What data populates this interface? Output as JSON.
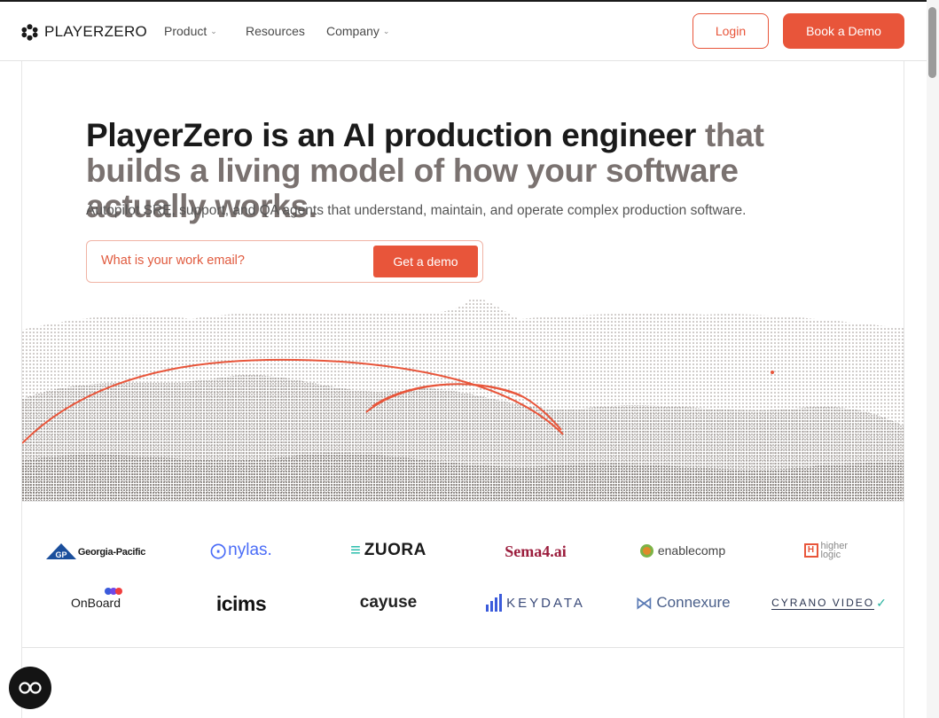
{
  "nav": {
    "brand": "PLAYERZERO",
    "items": [
      {
        "label": "Product",
        "has_dropdown": true
      },
      {
        "label": "Resources",
        "has_dropdown": false
      },
      {
        "label": "Company",
        "has_dropdown": true
      }
    ],
    "login_label": "Login",
    "book_demo_label": "Book a Demo"
  },
  "hero": {
    "headline_strong": "PlayerZero is an AI production engineer",
    "headline_muted": " that builds a living model of how your software actually works.",
    "subhead": "Autopilot SRE, support, and QA agents that understand, maintain, and operate complex production software.",
    "email_placeholder": "What is your work email?",
    "cta_label": "Get a demo"
  },
  "customer_logos": {
    "row1": [
      "Georgia-Pacific",
      "nylas.",
      "ZUORA",
      "Sema4.ai",
      "enablecomp",
      "higher logic"
    ],
    "row2": [
      "OnBoard",
      "icims",
      "cayuse",
      "KEYDATA",
      "Connexure",
      "CYRANO VIDEO"
    ]
  },
  "chat": {
    "icon": "chat-bubble-icon"
  },
  "colors": {
    "accent": "#e8553a",
    "text": "#1a1a1a",
    "muted": "#7a7270"
  }
}
